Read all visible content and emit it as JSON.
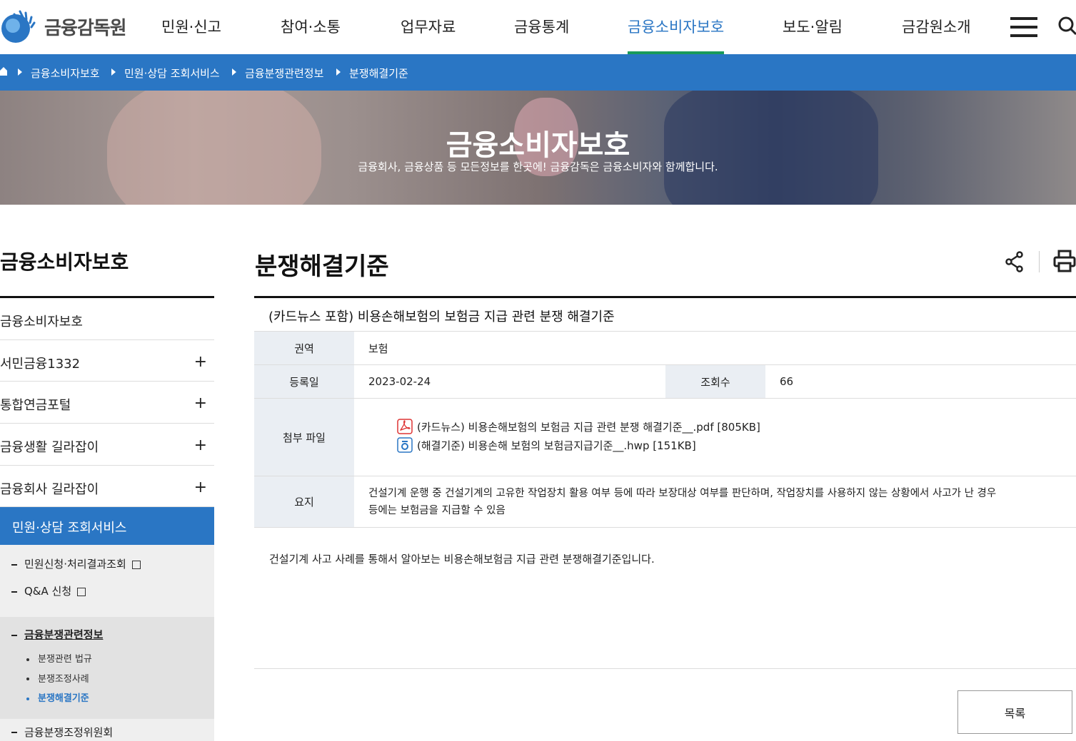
{
  "header": {
    "logo_text": "금융감독원",
    "nav": [
      "민원·신고",
      "참여·소통",
      "업무자료",
      "금융통계",
      "금융소비자보호",
      "보도·알림",
      "금감원소개"
    ],
    "active_nav": "금융소비자보호"
  },
  "breadcrumb": [
    "금융소비자보호",
    "민원·상담 조회서비스",
    "금융분쟁관련정보",
    "분쟁해결기준"
  ],
  "banner": {
    "title": "금융소비자보호",
    "subtitle": "금융회사, 금융상품 등 모든정보를 한곳에! 금융감독은 금융소비자와 함께합니다."
  },
  "lnb": {
    "title": "금융소비자보호",
    "items": [
      "금융소비자보호",
      "서민금융1332",
      "통합연금포털",
      "금융생활 길라잡이",
      "금융회사 길라잡이"
    ],
    "active": "민원·상담 조회서비스",
    "sub_items": [
      "민원신청·처리결과조회",
      "Q&A 신청"
    ],
    "sub2_head": "금융분쟁관련정보",
    "sub2_items": [
      "분쟁관련 법규",
      "분쟁조정사례",
      "분쟁해결기준"
    ],
    "bottom": "금융분쟁조정위원회"
  },
  "page": {
    "title": "분쟁해결기준"
  },
  "view": {
    "title": "(카드뉴스 포함) 비용손해보험의 보험금 지급 관련 분쟁 해결기준",
    "region_label": "권역",
    "region": "보험",
    "date_label": "등록일",
    "date": "2023-02-24",
    "views_label": "조회수",
    "views": "66",
    "files_label": "첨부 파일",
    "files": [
      "(카드뉴스) 비용손해보험의 보험금 지급 관련 분쟁 해결기준__.pdf [805KB]",
      "(해결기준) 비용손해 보험의 보험금지급기준__.hwp [151KB]"
    ],
    "summary_label": "요지",
    "summary_line1": "건설기계 운행 중 건설기계의 고유한 작업장치 활용 여부 등에 따라 보장대상 여부를 판단하며, 작업장치를 사용하지 않는 상황에서 사고가 난 경우",
    "summary_line2": "등에는 보험금을 지급할 수 있음",
    "description": "건설기계 사고 사례를 통해서 알아보는 비용손해보험금 지급 관련 분쟁해결기준입니다."
  },
  "buttons": {
    "list": "목록"
  },
  "colors": {
    "brand_blue": "#2a76c4",
    "active_underline": "#1a9a5a"
  }
}
